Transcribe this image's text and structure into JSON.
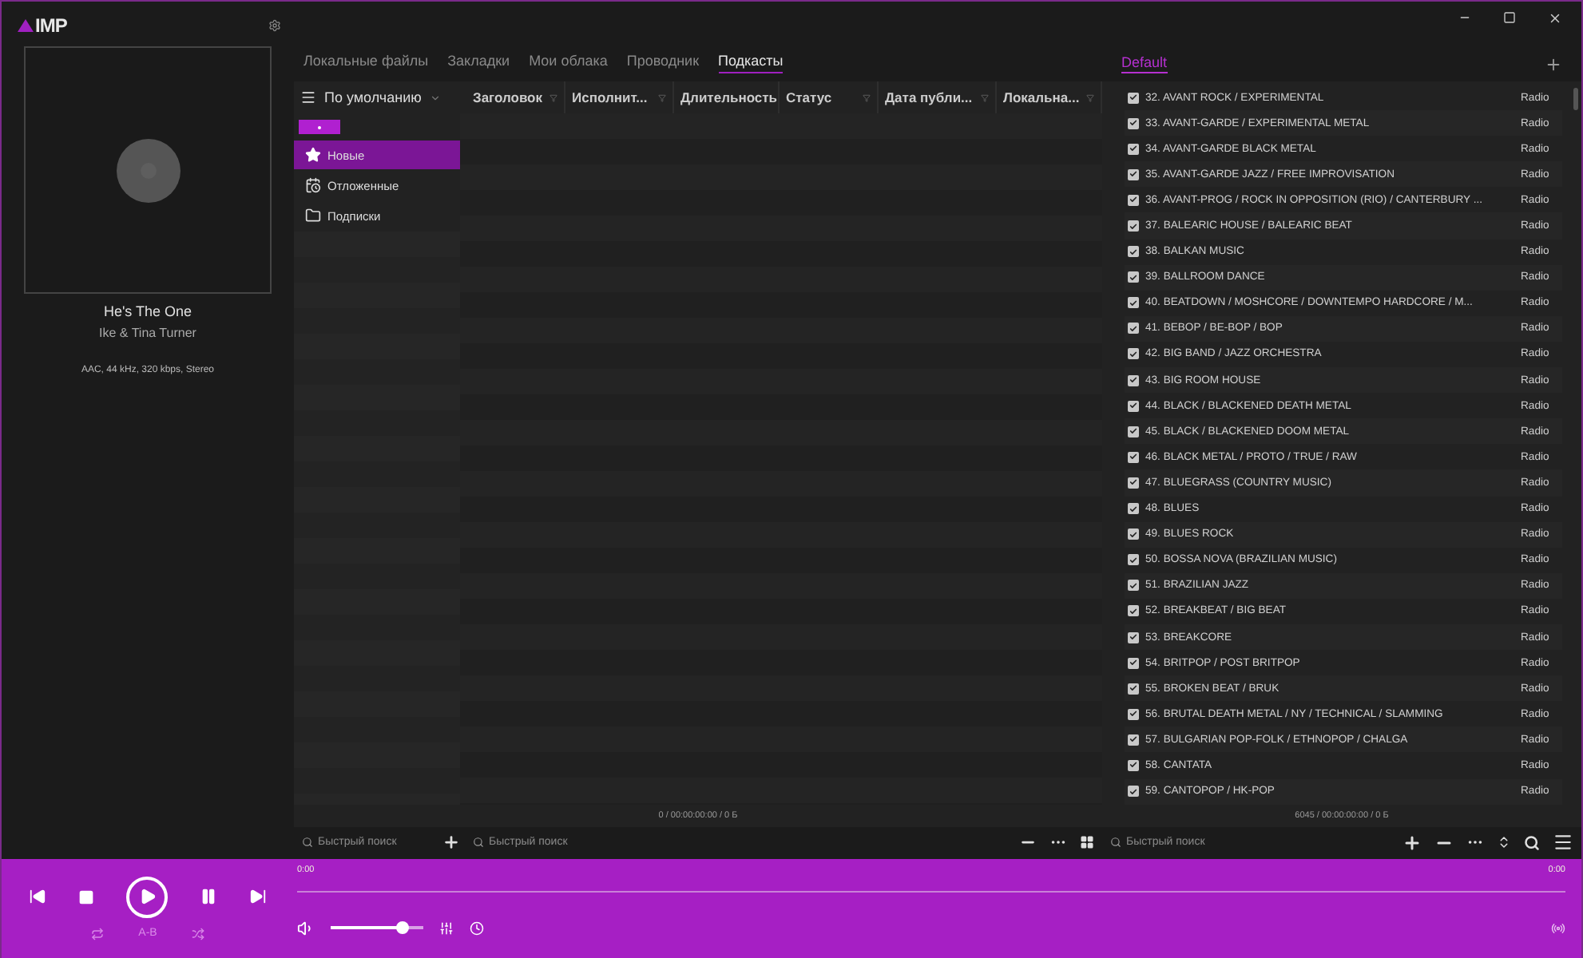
{
  "logo": "IMP",
  "now_playing": {
    "title": "He's The One",
    "artist": "Ike & Tina Turner",
    "info": "AAC, 44 kHz, 320 kbps, Stereo"
  },
  "tabs": [
    {
      "label": "Локальные файлы",
      "selected": false
    },
    {
      "label": "Закладки",
      "selected": false
    },
    {
      "label": "Мои облака",
      "selected": false
    },
    {
      "label": "Проводник",
      "selected": false
    },
    {
      "label": "Подкасты",
      "selected": true
    }
  ],
  "sort": {
    "label": "По умолчанию"
  },
  "columns": [
    "Заголовок",
    "Исполнит...",
    "Длительность",
    "Статус",
    "Дата публи...",
    "Локальна..."
  ],
  "nav": [
    {
      "label": "Новые",
      "kind": "star",
      "selected": true
    },
    {
      "label": "Отложенные",
      "kind": "later",
      "selected": false
    },
    {
      "label": "Подписки",
      "kind": "folder",
      "selected": false
    }
  ],
  "library_summary": "0 / 00:00:00:00 / 0 Б",
  "playlist_tabs": [
    {
      "label": "Default",
      "selected": true
    }
  ],
  "playlist": [
    {
      "name": "32. AVANT ROCK / EXPERIMENTAL",
      "type": "Radio",
      "checked": true
    },
    {
      "name": "33. AVANT-GARDE / EXPERIMENTAL METAL",
      "type": "Radio",
      "checked": true
    },
    {
      "name": "34. AVANT-GARDE BLACK METAL",
      "type": "Radio",
      "checked": true
    },
    {
      "name": "35. AVANT-GARDE JAZZ / FREE IMPROVISATION",
      "type": "Radio",
      "checked": true
    },
    {
      "name": "36. AVANT-PROG / ROCK IN OPPOSITION (RIO) / CANTERBURY ...",
      "type": "Radio",
      "checked": true
    },
    {
      "name": "37. BALEARIC HOUSE / BALEARIC BEAT",
      "type": "Radio",
      "checked": true
    },
    {
      "name": "38. BALKAN MUSIC",
      "type": "Radio",
      "checked": true
    },
    {
      "name": "39. BALLROOM DANCE",
      "type": "Radio",
      "checked": true
    },
    {
      "name": "40. BEATDOWN / MOSHCORE / DOWNTEMPO HARDCORE / M...",
      "type": "Radio",
      "checked": true
    },
    {
      "name": "41. BEBOP / BE-BOP / BOP",
      "type": "Radio",
      "checked": true
    },
    {
      "name": "42. BIG BAND / JAZZ ORCHESTRA",
      "type": "Radio",
      "checked": true
    },
    {
      "name": "43. BIG ROOM HOUSE",
      "type": "Radio",
      "checked": true
    },
    {
      "name": "44. BLACK / BLACKENED DEATH METAL",
      "type": "Radio",
      "checked": true
    },
    {
      "name": "45. BLACK / BLACKENED DOOM METAL",
      "type": "Radio",
      "checked": true
    },
    {
      "name": "46. BLACK METAL / PROTO / TRUE / RAW",
      "type": "Radio",
      "checked": true
    },
    {
      "name": "47. BLUEGRASS (COUNTRY MUSIC)",
      "type": "Radio",
      "checked": true
    },
    {
      "name": "48. BLUES",
      "type": "Radio",
      "checked": true
    },
    {
      "name": "49. BLUES ROCK",
      "type": "Radio",
      "checked": true
    },
    {
      "name": "50. BOSSA NOVA (BRAZILIAN MUSIC)",
      "type": "Radio",
      "checked": true
    },
    {
      "name": "51. BRAZILIAN JAZZ",
      "type": "Radio",
      "checked": true
    },
    {
      "name": "52. BREAKBEAT / BIG BEAT",
      "type": "Radio",
      "checked": true
    },
    {
      "name": "53. BREAKCORE",
      "type": "Radio",
      "checked": true
    },
    {
      "name": "54. BRITPOP / POST BRITPOP",
      "type": "Radio",
      "checked": true
    },
    {
      "name": "55. BROKEN BEAT / BRUK",
      "type": "Radio",
      "checked": true
    },
    {
      "name": "56. BRUTAL DEATH METAL / NY / TECHNICAL / SLAMMING",
      "type": "Radio",
      "checked": true
    },
    {
      "name": "57. BULGARIAN POP-FOLK / ETHNOPOP / CHALGA",
      "type": "Radio",
      "checked": true
    },
    {
      "name": "58. CANTATA",
      "type": "Radio",
      "checked": true
    },
    {
      "name": "59. CANTOPOP / HK-POP",
      "type": "Radio",
      "checked": true
    }
  ],
  "playlist_summary": "6045 / 00:00:00:00 / 0 Б",
  "search": [
    {
      "placeholder": "Быстрый поиск"
    },
    {
      "placeholder": "Быстрый поиск"
    },
    {
      "placeholder": "Быстрый поиск"
    }
  ],
  "player": {
    "position": "0:00",
    "duration": "0:00",
    "progress": {
      "level": 0
    },
    "volume": {
      "level": 0.78
    },
    "ab_label": "A-B"
  }
}
